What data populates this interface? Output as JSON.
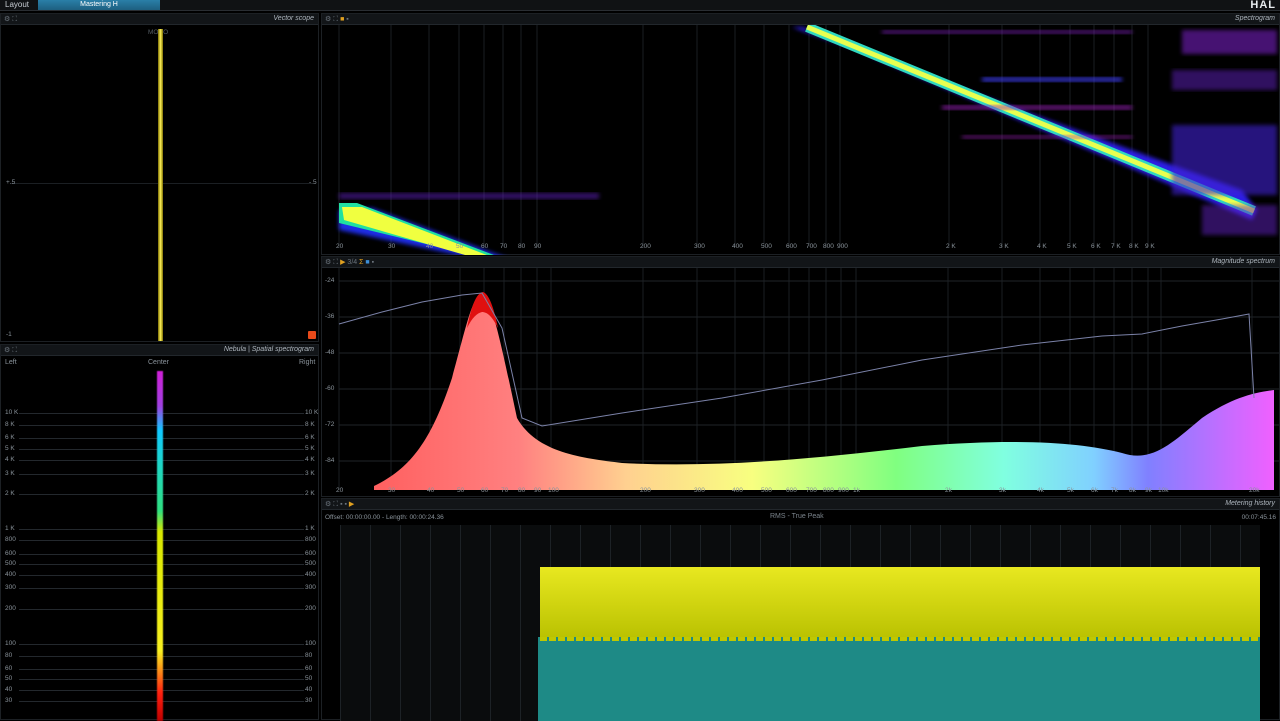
{
  "menu": {
    "layout_label": "Layout",
    "preset_tab": "Mastering H",
    "brand": "HAL"
  },
  "vectorscope": {
    "title": "Vector scope",
    "mono_label": "MONO",
    "tick_plus": "+.5",
    "tick_minus": "-.5",
    "tick_bottom": "-1"
  },
  "nebula": {
    "title": "Nebula | Spatial spectrogram",
    "left_label": "Left",
    "center_label": "Center",
    "right_label": "Right",
    "freq_labels": [
      "10 K",
      "8 K",
      "6 K",
      "5 K",
      "4 K",
      "3 K",
      "2 K",
      "1 K",
      "800",
      "600",
      "500",
      "400",
      "300",
      "200",
      "100",
      "80",
      "60",
      "50",
      "40",
      "30"
    ]
  },
  "spectrogram": {
    "title": "Spectrogram",
    "freq_labels": [
      "20",
      "30",
      "40",
      "50",
      "60",
      "70",
      "80",
      "90",
      "200",
      "300",
      "400",
      "500",
      "600",
      "700",
      "800",
      "900",
      "2 K",
      "3 K",
      "4 K",
      "5 K",
      "6 K",
      "7 K",
      "8 K",
      "9 K"
    ]
  },
  "magnitude": {
    "title": "Magnitude spectrum",
    "toolbar_value": "3/4",
    "db_labels": [
      "-24",
      "-36",
      "-48",
      "-60",
      "-72",
      "-84"
    ],
    "freq_labels": [
      "20",
      "30",
      "40",
      "50",
      "60",
      "70",
      "80",
      "90",
      "100",
      "200",
      "300",
      "400",
      "500",
      "600",
      "700",
      "800",
      "900",
      "1k",
      "2k",
      "3k",
      "4k",
      "5k",
      "6k",
      "7k",
      "8k",
      "9k",
      "10k",
      "20k"
    ]
  },
  "history": {
    "title": "Metering history",
    "offset_text": "Offset: 00:00:00.00 - Length: 00:00:24.36",
    "mode_text": "RMS - True Peak",
    "time_text": "00:07:45.16"
  }
}
